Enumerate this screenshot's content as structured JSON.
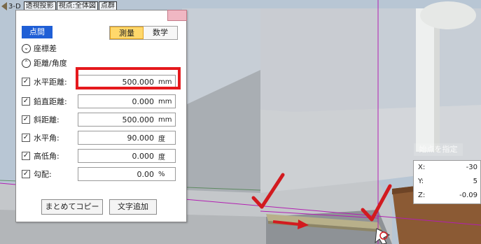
{
  "toolbar": {
    "label": "3-D",
    "tabs": [
      "透視投影",
      "視点:全体図",
      "点群"
    ]
  },
  "panel": {
    "point_badge": "点間",
    "mode_tabs": [
      {
        "label": "測量",
        "active": true
      },
      {
        "label": "数学",
        "active": false
      }
    ],
    "sections": {
      "coord_diff": "座標差",
      "dist_angle": "距離/角度"
    },
    "rows": [
      {
        "label": "水平距離:",
        "value": "500.000",
        "unit": "mm",
        "checked": true
      },
      {
        "label": "鉛直距離:",
        "value": "0.000",
        "unit": "mm",
        "checked": true
      },
      {
        "label": "斜距離:",
        "value": "500.000",
        "unit": "mm",
        "checked": true
      },
      {
        "label": "水平角:",
        "value": "90.000",
        "unit": "度",
        "checked": true
      },
      {
        "label": "高低角:",
        "value": "0.000",
        "unit": "度",
        "checked": true
      },
      {
        "label": "勾配:",
        "value": "0.00",
        "unit": "%",
        "checked": true
      }
    ],
    "buttons": {
      "copy_all": "まとめてコピー",
      "add_text": "文字追加"
    }
  },
  "coords": {
    "title": "始点を指定",
    "rows": [
      {
        "key": "X:",
        "value": "-30"
      },
      {
        "key": "Y:",
        "value": "5"
      },
      {
        "key": "Z:",
        "value": "-0.09"
      }
    ]
  },
  "colors": {
    "highlight": "#e5191d",
    "badge": "#1f5fd6",
    "active_tab": "#ffd86b",
    "guide_line": "#b21fb2"
  }
}
